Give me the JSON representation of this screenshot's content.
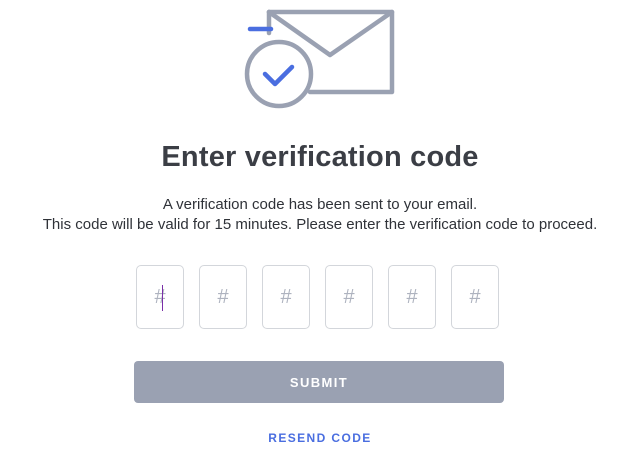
{
  "illustration": {
    "icon": "email-check-icon",
    "colors": {
      "outline": "#9aa1b2",
      "accent": "#4a6ee0"
    }
  },
  "title": "Enter verification code",
  "subtitle": {
    "line1": "A verification code has been sent to your email.",
    "line2": "This code will be valid for 15 minutes. Please enter the verification code to proceed."
  },
  "code_inputs": [
    {
      "value": "",
      "placeholder": "#",
      "focused": true
    },
    {
      "value": "",
      "placeholder": "#"
    },
    {
      "value": "",
      "placeholder": "#"
    },
    {
      "value": "",
      "placeholder": "#"
    },
    {
      "value": "",
      "placeholder": "#"
    },
    {
      "value": "",
      "placeholder": "#"
    }
  ],
  "submit": {
    "label": "SUBMIT",
    "color": "#9aa1b2"
  },
  "resend": {
    "label": "RESEND CODE",
    "color": "#4a6ee0"
  }
}
